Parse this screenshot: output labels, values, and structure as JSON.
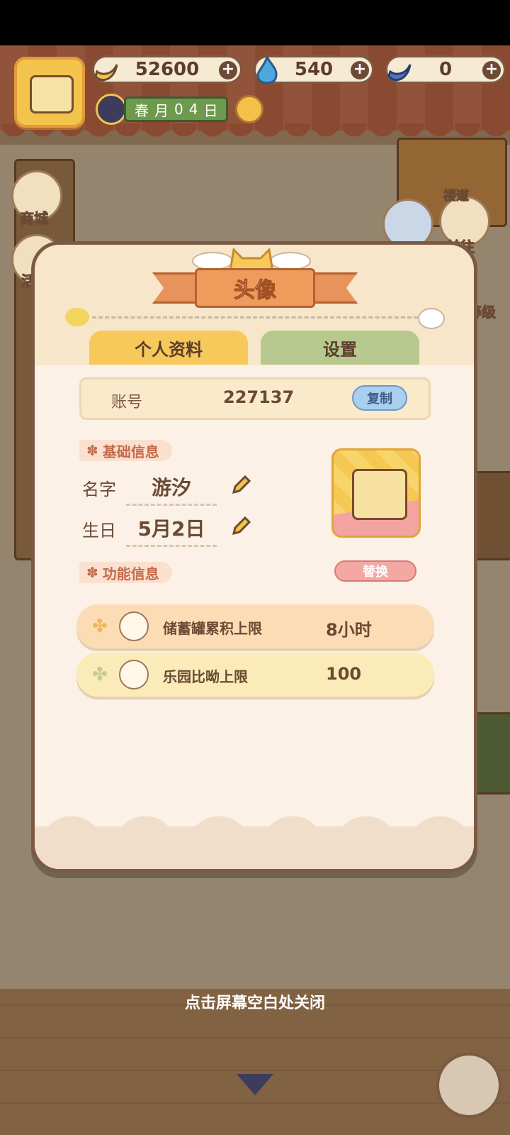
{
  "hud": {
    "bananas": "52600",
    "flames": "540",
    "blue_bananas": "0",
    "date": {
      "season": "春",
      "month_label": "月",
      "day_digits": [
        "0",
        "4"
      ],
      "day_label": "日"
    }
  },
  "side_menu": {
    "shop": "商城",
    "activity": "活",
    "go": "前往",
    "level": "等级",
    "sign": "楼道"
  },
  "dialog": {
    "title": "头像",
    "tabs": {
      "profile": "个人资料",
      "settings": "设置"
    },
    "account": {
      "label": "账号",
      "value": "227137",
      "copy": "复制"
    },
    "basic_section": "基础信息",
    "name_label": "名字",
    "name_value": "游汐",
    "birthday_label": "生日",
    "birthday_value": "5月2日",
    "replace": "替换",
    "func_section": "功能信息",
    "rows": [
      {
        "name": "储蓄罐累积上限",
        "value": "8小时"
      },
      {
        "name": "乐园比呦上限",
        "value": "100"
      }
    ]
  },
  "close_hint": "点击屏幕空白处关闭",
  "colors": {
    "accent": "#ef9b5c",
    "tab_active": "#f6c95a",
    "tab_inactive": "#b7c98e"
  },
  "icons": [
    "banana-icon",
    "blue-flame-icon",
    "blue-banana-icon",
    "clock-icon",
    "sun-icon",
    "pencil-icon",
    "clover-icon",
    "yarn-ball-icon",
    "down-arrow-icon"
  ]
}
